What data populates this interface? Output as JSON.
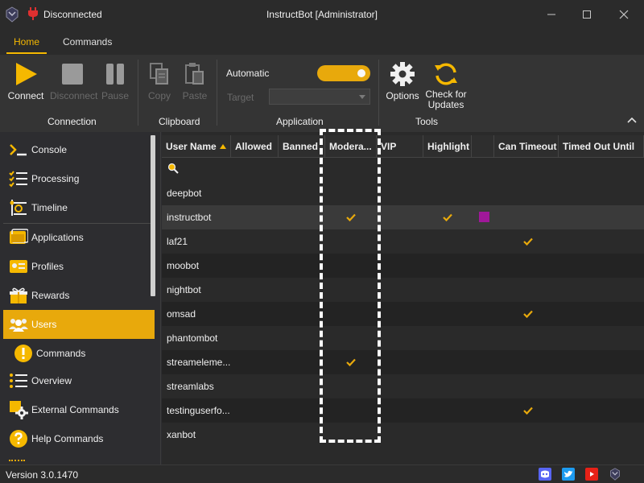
{
  "titlebar": {
    "connection_status": "Disconnected",
    "title": "InstructBot [Administrator]",
    "icons": [
      "app-logo-icon",
      "plug-icon",
      "minimize-icon",
      "maximize-icon",
      "close-icon"
    ]
  },
  "menu": {
    "home": "Home",
    "commands": "Commands",
    "active": "Home"
  },
  "ribbon": {
    "connection": {
      "label": "Connection",
      "connect": "Connect",
      "disconnect": "Disconnect",
      "pause": "Pause"
    },
    "clipboard": {
      "label": "Clipboard",
      "copy": "Copy",
      "paste": "Paste"
    },
    "application": {
      "label": "Application",
      "automatic_label": "Automatic",
      "automatic_on": true,
      "target_label": "Target",
      "target_value": ""
    },
    "tools": {
      "label": "Tools",
      "options": "Options",
      "check_updates_line1": "Check for",
      "check_updates_line2": "Updates"
    }
  },
  "sidebar": {
    "items": [
      {
        "label": "Console",
        "icon": "console-icon"
      },
      {
        "label": "Processing",
        "icon": "processing-icon"
      },
      {
        "label": "Timeline",
        "icon": "timeline-icon"
      },
      {
        "label": "Applications",
        "icon": "applications-icon"
      },
      {
        "label": "Profiles",
        "icon": "profiles-icon"
      },
      {
        "label": "Rewards",
        "icon": "rewards-icon"
      },
      {
        "label": "Users",
        "icon": "users-icon",
        "active": true
      },
      {
        "label": "Commands",
        "icon": "warning-icon"
      },
      {
        "label": "Overview",
        "icon": "overview-icon"
      },
      {
        "label": "External Commands",
        "icon": "external-commands-icon"
      },
      {
        "label": "Help Commands",
        "icon": "help-icon"
      }
    ]
  },
  "grid": {
    "columns": [
      "User Name",
      "Allowed",
      "Banned",
      "Modera...",
      "VIP",
      "Highlight",
      "",
      "Can Timeout",
      "Timed Out Until"
    ],
    "sort_column": "User Name",
    "sort_direction": "ascending",
    "rows": [
      {
        "name": "deepbot",
        "moderator": false,
        "highlight": false,
        "color": "",
        "can_timeout": false
      },
      {
        "name": "instructbot",
        "moderator": true,
        "highlight": true,
        "color": "#a0189a",
        "can_timeout": false
      },
      {
        "name": "laf21",
        "moderator": false,
        "highlight": false,
        "color": "",
        "can_timeout": true
      },
      {
        "name": "moobot",
        "moderator": false,
        "highlight": false,
        "color": "",
        "can_timeout": false
      },
      {
        "name": "nightbot",
        "moderator": false,
        "highlight": false,
        "color": "",
        "can_timeout": false
      },
      {
        "name": "omsad",
        "moderator": false,
        "highlight": false,
        "color": "",
        "can_timeout": true
      },
      {
        "name": "phantombot",
        "moderator": false,
        "highlight": false,
        "color": "",
        "can_timeout": false
      },
      {
        "name": "streameleme...",
        "moderator": true,
        "highlight": false,
        "color": "",
        "can_timeout": false
      },
      {
        "name": "streamlabs",
        "moderator": false,
        "highlight": false,
        "color": "",
        "can_timeout": false
      },
      {
        "name": "testinguserfo...",
        "moderator": false,
        "highlight": false,
        "color": "",
        "can_timeout": true
      },
      {
        "name": "xanbot",
        "moderator": false,
        "highlight": false,
        "color": "",
        "can_timeout": false
      }
    ]
  },
  "statusbar": {
    "version": "Version 3.0.1470",
    "icons": [
      "discord-icon",
      "twitter-icon",
      "youtube-icon",
      "app-logo-icon"
    ]
  },
  "colors": {
    "accent": "#e8a90c",
    "check": "#e8a90c",
    "background": "#2d2d30"
  }
}
